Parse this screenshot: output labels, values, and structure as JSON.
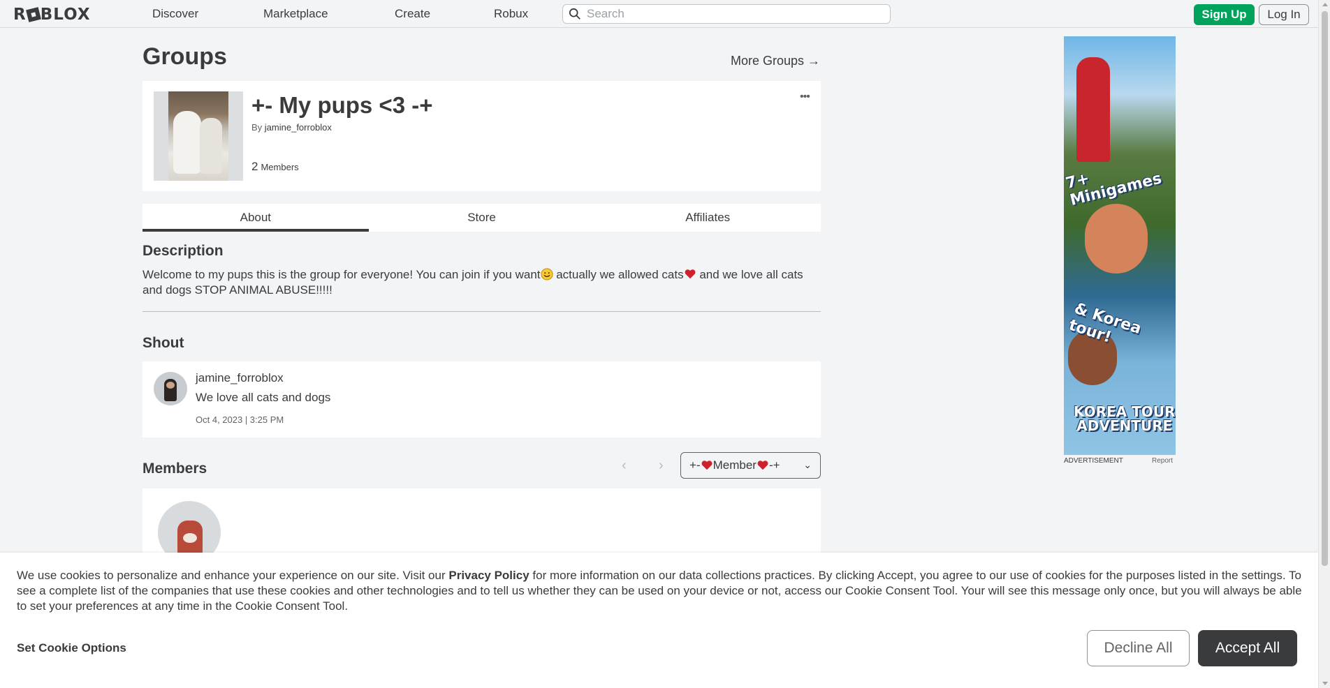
{
  "nav": {
    "logo": "R   BLOX",
    "links": [
      "Discover",
      "Marketplace",
      "Create",
      "Robux"
    ],
    "search_placeholder": "Search",
    "signup": "Sign Up",
    "login": "Log In"
  },
  "page": {
    "title": "Groups",
    "more_groups": "More Groups →"
  },
  "group": {
    "name": "+- My pups <3 -+",
    "by_prefix": "By",
    "owner": "jamine_forroblox",
    "member_count": "2",
    "member_label": "Members",
    "menu_icon": "more-dots-icon"
  },
  "tabs": [
    "About",
    "Store",
    "Affiliates"
  ],
  "description": {
    "heading": "Description",
    "part1": "Welcome to my pups this is the group for everyone! You can join if you want",
    "part2": " actually we allowed cats",
    "part3": " and we love all cats and dogs STOP ANIMAL ABUSE!!!!!"
  },
  "shout": {
    "heading": "Shout",
    "user": "jamine_forroblox",
    "text": "We love all cats and dogs",
    "date": "Oct 4, 2023 | 3:25 PM"
  },
  "members": {
    "heading": "Members",
    "rank_prefix": "+-",
    "rank_name": "Member",
    "rank_suffix": "-+"
  },
  "ad": {
    "headline1": "7+ Minigames",
    "headline2": "& Korea tour!",
    "headline3_line1": "KOREA TOUR",
    "headline3_line2": "ADVENTURE",
    "label": "ADVERTISEMENT",
    "report": "Report"
  },
  "cookie": {
    "text_before": "We use cookies to personalize and enhance your experience on our site. Visit our ",
    "policy_link": "Privacy Policy",
    "text_after": " for more information on our data collections practices. By clicking Accept, you agree to our use of cookies for the purposes listed in the settings. To see a complete list of the companies that use these cookies and other technologies and to tell us whether they can be used on your device or not, access our Cookie Consent Tool. Your will see this message only once, but you will always be able to set your preferences at any time in the Cookie Consent Tool.",
    "options": "Set Cookie Options",
    "decline": "Decline All",
    "accept": "Accept All"
  },
  "colors": {
    "signup_green": "#00a35c",
    "accept_dark": "#393b3d",
    "background": "#f2f4f5"
  }
}
